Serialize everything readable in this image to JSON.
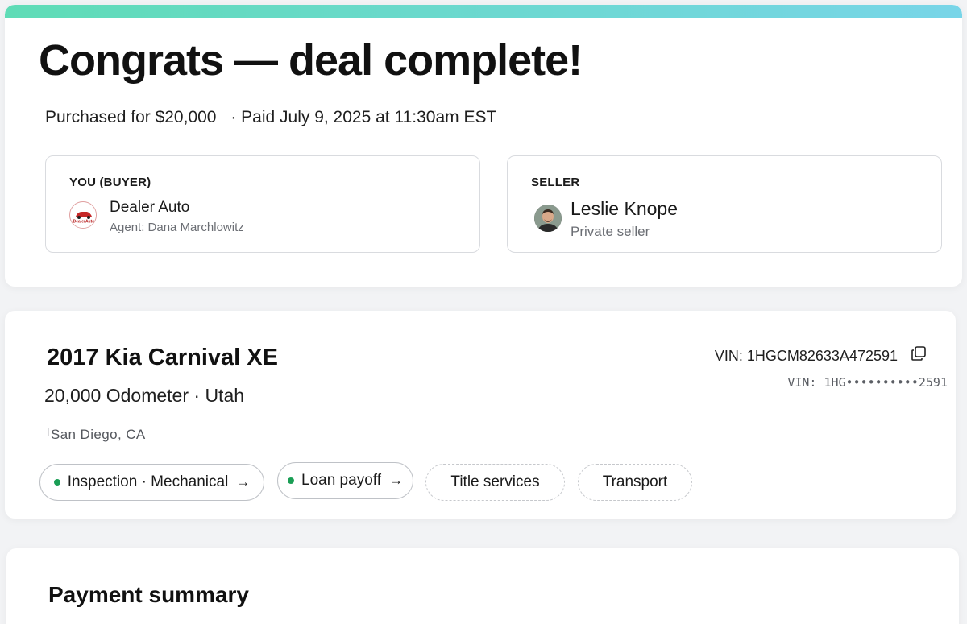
{
  "accent_gradient": [
    "#5fdcb6",
    "#78d5e8"
  ],
  "deal": {
    "title": "Congrats — deal complete!",
    "purchase_text": "Purchased for $20,000",
    "paid_text": "· Paid July 9, 2025 at 11:30am EST"
  },
  "buyer": {
    "label": "YOU (BUYER)",
    "name": "Dealer Auto",
    "agent": "Agent: Dana Marchlowitz",
    "logo_icon": "dealer-auto-logo",
    "logo_text": "DealerAuto"
  },
  "seller": {
    "label": "SELLER",
    "name": "Leslie Knope",
    "type": "Private seller",
    "avatar_icon": "user-photo-avatar"
  },
  "vehicle": {
    "title": "2017 Kia Carnival XE",
    "meta": "20,000 Odometer · Utah",
    "location_mark": "ⵏ",
    "location": "San Diego, CA",
    "vin_full": "VIN: 1HGCM82633A472591",
    "vin_masked": "VIN: 1HG••••••••••2591",
    "copy_icon": "copy-icon"
  },
  "services": [
    {
      "label": "Inspection · Mechanical",
      "status": "done",
      "arrow": "→"
    },
    {
      "label": "Loan payoff",
      "status": "done",
      "arrow": "→"
    },
    {
      "label": "Title services",
      "status": "todo",
      "arrow": ""
    },
    {
      "label": "Transport",
      "status": "todo",
      "arrow": ""
    }
  ],
  "status_colors": {
    "done": "#1a9e55"
  },
  "payment": {
    "title": "Payment summary"
  }
}
